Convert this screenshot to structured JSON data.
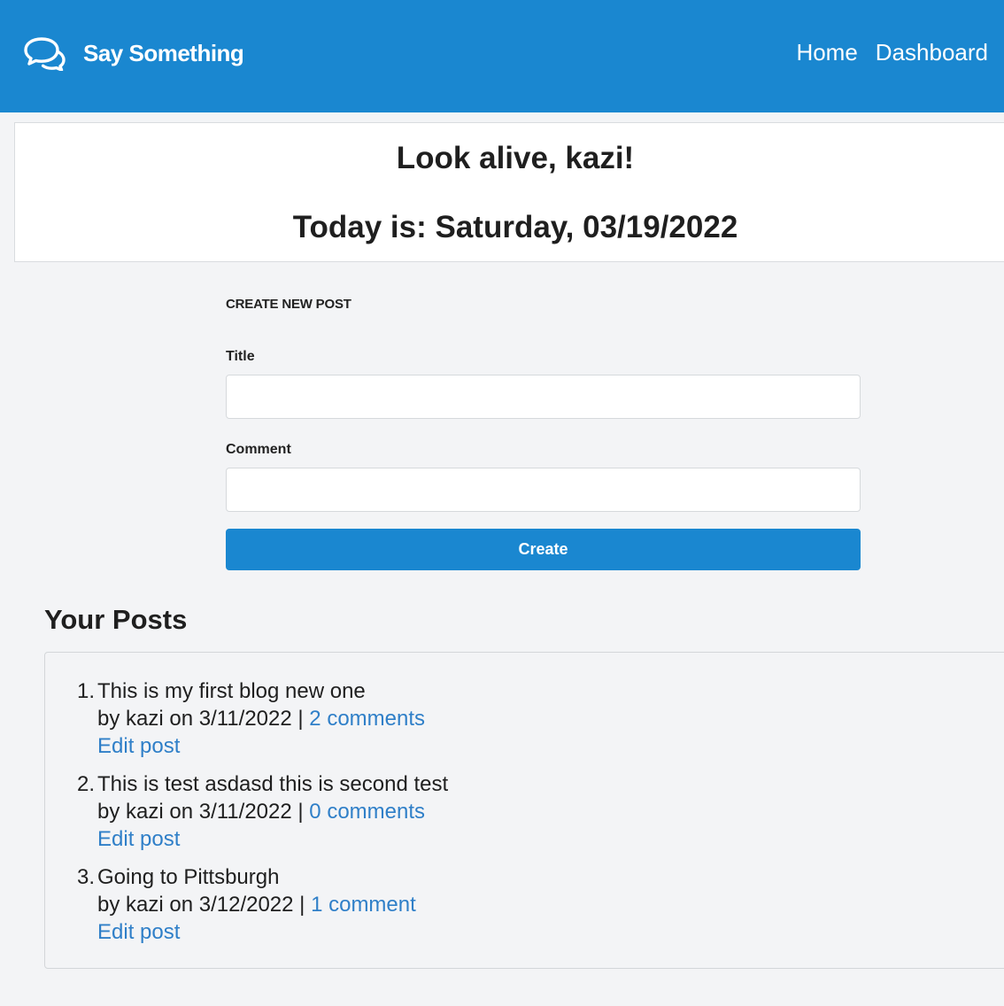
{
  "header": {
    "brand": "Say Something",
    "brand_icon": "chat-bubbles-icon",
    "nav": {
      "home": "Home",
      "dashboard": "Dashboard"
    },
    "color": "#1a87d0"
  },
  "greeting": {
    "hello": "Look alive, kazi!",
    "date": "Today is: Saturday, 03/19/2022"
  },
  "create_post": {
    "heading": "Create New Post",
    "title_label": "Title",
    "title_value": "",
    "comment_label": "Comment",
    "comment_value": "",
    "button_label": "Create"
  },
  "posts": {
    "heading": "Your Posts",
    "items": [
      {
        "number": "1.",
        "title": "This is my first blog new one",
        "byline": "by kazi on 3/11/2022 | ",
        "comments": "2 comments",
        "edit": "Edit post"
      },
      {
        "number": "2.",
        "title": "This is test asdasd this is second test",
        "byline": "by kazi on 3/11/2022 | ",
        "comments": "0 comments",
        "edit": "Edit post"
      },
      {
        "number": "3.",
        "title": "Going to Pittsburgh",
        "byline": "by kazi on 3/12/2022 | ",
        "comments": "1 comment",
        "edit": "Edit post"
      }
    ]
  },
  "colors": {
    "accent": "#1a87d0",
    "link": "#2f7fc8",
    "background": "#f3f4f6"
  }
}
